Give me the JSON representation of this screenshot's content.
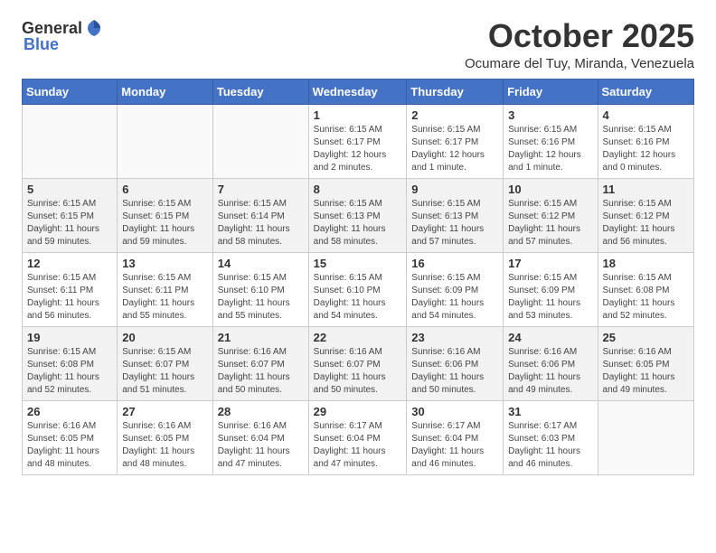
{
  "header": {
    "logo_general": "General",
    "logo_blue": "Blue",
    "month_title": "October 2025",
    "location": "Ocumare del Tuy, Miranda, Venezuela"
  },
  "weekdays": [
    "Sunday",
    "Monday",
    "Tuesday",
    "Wednesday",
    "Thursday",
    "Friday",
    "Saturday"
  ],
  "weeks": [
    [
      {
        "day": "",
        "info": ""
      },
      {
        "day": "",
        "info": ""
      },
      {
        "day": "",
        "info": ""
      },
      {
        "day": "1",
        "info": "Sunrise: 6:15 AM\nSunset: 6:17 PM\nDaylight: 12 hours\nand 2 minutes."
      },
      {
        "day": "2",
        "info": "Sunrise: 6:15 AM\nSunset: 6:17 PM\nDaylight: 12 hours\nand 1 minute."
      },
      {
        "day": "3",
        "info": "Sunrise: 6:15 AM\nSunset: 6:16 PM\nDaylight: 12 hours\nand 1 minute."
      },
      {
        "day": "4",
        "info": "Sunrise: 6:15 AM\nSunset: 6:16 PM\nDaylight: 12 hours\nand 0 minutes."
      }
    ],
    [
      {
        "day": "5",
        "info": "Sunrise: 6:15 AM\nSunset: 6:15 PM\nDaylight: 11 hours\nand 59 minutes."
      },
      {
        "day": "6",
        "info": "Sunrise: 6:15 AM\nSunset: 6:15 PM\nDaylight: 11 hours\nand 59 minutes."
      },
      {
        "day": "7",
        "info": "Sunrise: 6:15 AM\nSunset: 6:14 PM\nDaylight: 11 hours\nand 58 minutes."
      },
      {
        "day": "8",
        "info": "Sunrise: 6:15 AM\nSunset: 6:13 PM\nDaylight: 11 hours\nand 58 minutes."
      },
      {
        "day": "9",
        "info": "Sunrise: 6:15 AM\nSunset: 6:13 PM\nDaylight: 11 hours\nand 57 minutes."
      },
      {
        "day": "10",
        "info": "Sunrise: 6:15 AM\nSunset: 6:12 PM\nDaylight: 11 hours\nand 57 minutes."
      },
      {
        "day": "11",
        "info": "Sunrise: 6:15 AM\nSunset: 6:12 PM\nDaylight: 11 hours\nand 56 minutes."
      }
    ],
    [
      {
        "day": "12",
        "info": "Sunrise: 6:15 AM\nSunset: 6:11 PM\nDaylight: 11 hours\nand 56 minutes."
      },
      {
        "day": "13",
        "info": "Sunrise: 6:15 AM\nSunset: 6:11 PM\nDaylight: 11 hours\nand 55 minutes."
      },
      {
        "day": "14",
        "info": "Sunrise: 6:15 AM\nSunset: 6:10 PM\nDaylight: 11 hours\nand 55 minutes."
      },
      {
        "day": "15",
        "info": "Sunrise: 6:15 AM\nSunset: 6:10 PM\nDaylight: 11 hours\nand 54 minutes."
      },
      {
        "day": "16",
        "info": "Sunrise: 6:15 AM\nSunset: 6:09 PM\nDaylight: 11 hours\nand 54 minutes."
      },
      {
        "day": "17",
        "info": "Sunrise: 6:15 AM\nSunset: 6:09 PM\nDaylight: 11 hours\nand 53 minutes."
      },
      {
        "day": "18",
        "info": "Sunrise: 6:15 AM\nSunset: 6:08 PM\nDaylight: 11 hours\nand 52 minutes."
      }
    ],
    [
      {
        "day": "19",
        "info": "Sunrise: 6:15 AM\nSunset: 6:08 PM\nDaylight: 11 hours\nand 52 minutes."
      },
      {
        "day": "20",
        "info": "Sunrise: 6:15 AM\nSunset: 6:07 PM\nDaylight: 11 hours\nand 51 minutes."
      },
      {
        "day": "21",
        "info": "Sunrise: 6:16 AM\nSunset: 6:07 PM\nDaylight: 11 hours\nand 50 minutes."
      },
      {
        "day": "22",
        "info": "Sunrise: 6:16 AM\nSunset: 6:07 PM\nDaylight: 11 hours\nand 50 minutes."
      },
      {
        "day": "23",
        "info": "Sunrise: 6:16 AM\nSunset: 6:06 PM\nDaylight: 11 hours\nand 50 minutes."
      },
      {
        "day": "24",
        "info": "Sunrise: 6:16 AM\nSunset: 6:06 PM\nDaylight: 11 hours\nand 49 minutes."
      },
      {
        "day": "25",
        "info": "Sunrise: 6:16 AM\nSunset: 6:05 PM\nDaylight: 11 hours\nand 49 minutes."
      }
    ],
    [
      {
        "day": "26",
        "info": "Sunrise: 6:16 AM\nSunset: 6:05 PM\nDaylight: 11 hours\nand 48 minutes."
      },
      {
        "day": "27",
        "info": "Sunrise: 6:16 AM\nSunset: 6:05 PM\nDaylight: 11 hours\nand 48 minutes."
      },
      {
        "day": "28",
        "info": "Sunrise: 6:16 AM\nSunset: 6:04 PM\nDaylight: 11 hours\nand 47 minutes."
      },
      {
        "day": "29",
        "info": "Sunrise: 6:17 AM\nSunset: 6:04 PM\nDaylight: 11 hours\nand 47 minutes."
      },
      {
        "day": "30",
        "info": "Sunrise: 6:17 AM\nSunset: 6:04 PM\nDaylight: 11 hours\nand 46 minutes."
      },
      {
        "day": "31",
        "info": "Sunrise: 6:17 AM\nSunset: 6:03 PM\nDaylight: 11 hours\nand 46 minutes."
      },
      {
        "day": "",
        "info": ""
      }
    ]
  ]
}
